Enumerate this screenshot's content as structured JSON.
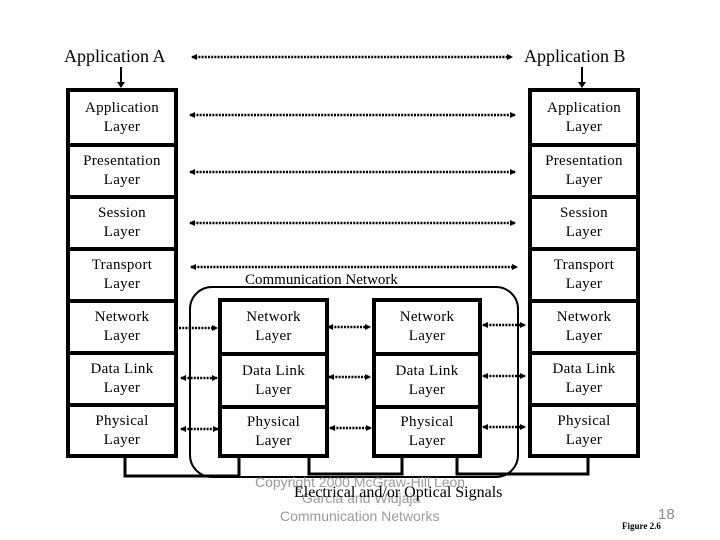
{
  "diagram": {
    "app_a": "Application A",
    "app_b": "Application B",
    "left_stack": [
      {
        "line1": "Application",
        "line2": "Layer"
      },
      {
        "line1": "Presentation",
        "line2": "Layer"
      },
      {
        "line1": "Session",
        "line2": "Layer"
      },
      {
        "line1": "Transport",
        "line2": "Layer"
      },
      {
        "line1": "Network",
        "line2": "Layer"
      },
      {
        "line1": "Data Link",
        "line2": "Layer"
      },
      {
        "line1": "Physical",
        "line2": "Layer"
      }
    ],
    "right_stack": [
      {
        "line1": "Application",
        "line2": "Layer"
      },
      {
        "line1": "Presentation",
        "line2": "Layer"
      },
      {
        "line1": "Session",
        "line2": "Layer"
      },
      {
        "line1": "Transport",
        "line2": "Layer"
      },
      {
        "line1": "Network",
        "line2": "Layer"
      },
      {
        "line1": "Data Link",
        "line2": "Layer"
      },
      {
        "line1": "Physical",
        "line2": "Layer"
      }
    ],
    "router1_stack": [
      {
        "line1": "Network",
        "line2": "Layer"
      },
      {
        "line1": "Data Link",
        "line2": "Layer"
      },
      {
        "line1": "Physical",
        "line2": "Layer"
      }
    ],
    "router2_stack": [
      {
        "line1": "Network",
        "line2": "Layer"
      },
      {
        "line1": "Data Link",
        "line2": "Layer"
      },
      {
        "line1": "Physical",
        "line2": "Layer"
      }
    ],
    "communication_network_label": "Communication Network",
    "signals_label": "Electrical and/or Optical Signals"
  },
  "footer": {
    "copyright_line1": "Copyright 2000 McGraw-Hill Leon",
    "copyright_line2": "Garcia and Widjaja",
    "copyright_line3": "Communication Networks",
    "page_number": "18",
    "figure_label": "Figure 2.6"
  }
}
